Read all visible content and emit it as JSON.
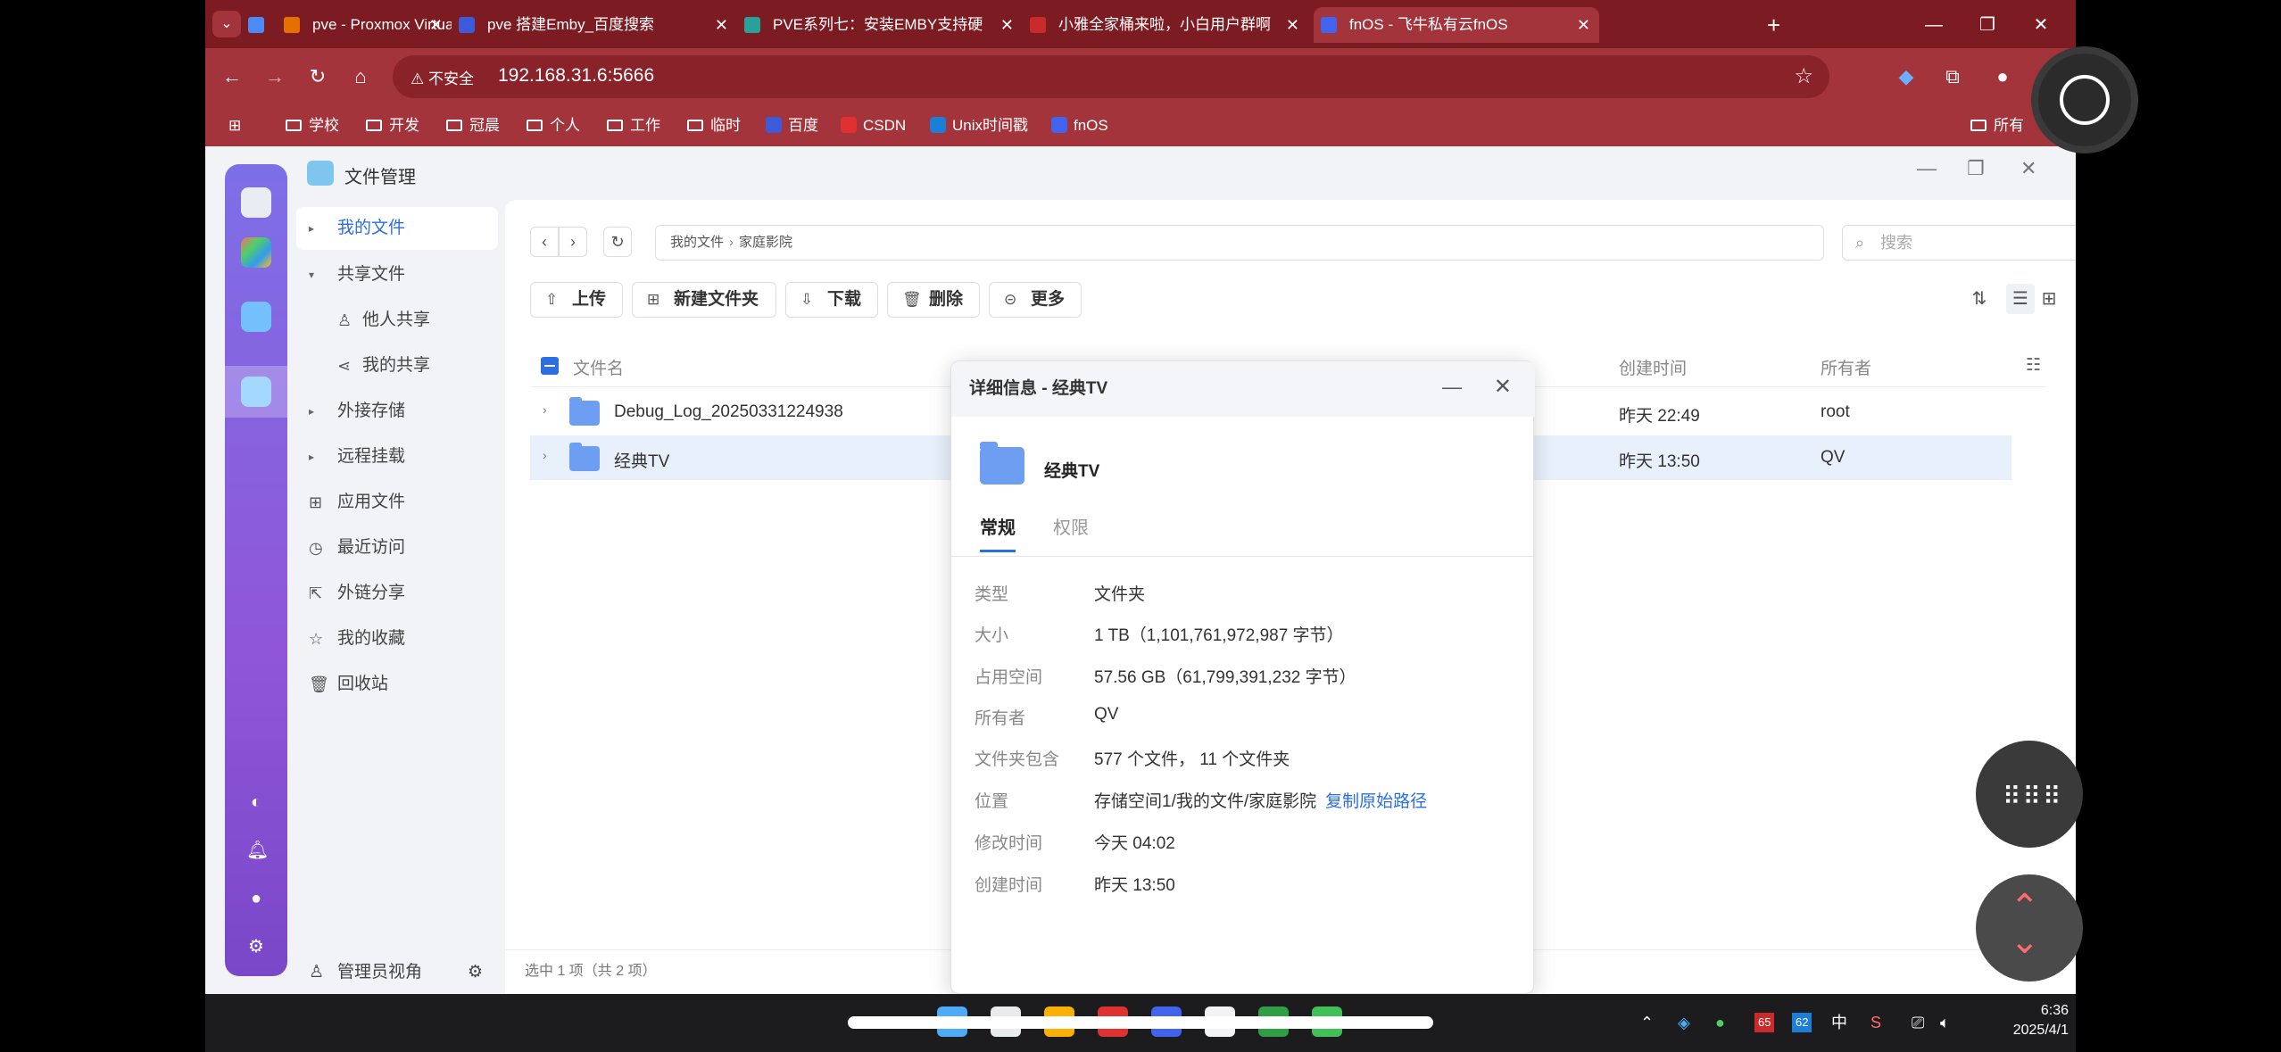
{
  "browser": {
    "tabs": [
      {
        "title": "pve - Proxmox Virtual Enviro",
        "icon_color": "#e57000"
      },
      {
        "title": "pve 搭建Emby_百度搜索",
        "icon_color": "#3b5bdb"
      },
      {
        "title": "PVE系列七：安装EMBY支持硬",
        "icon_color": "#2aa198"
      },
      {
        "title": "小雅全家桶来啦，小白用户群啊",
        "icon_color": "#c92a2a"
      },
      {
        "title": "fnOS - 飞牛私有云fnOS",
        "icon_color": "#4263eb"
      }
    ],
    "security_label": "不安全",
    "url": "192.168.31.6:5666",
    "bookmarks": [
      "学校",
      "开发",
      "冠晨",
      "个人",
      "工作",
      "临时",
      "百度",
      "CSDN",
      "Unix时间戳",
      "fnOS"
    ],
    "bookmarks_overflow": "所有"
  },
  "app": {
    "title": "文件管理",
    "sidebar": {
      "my_files": "我的文件",
      "shared_files": "共享文件",
      "others_share": "他人共享",
      "my_share": "我的共享",
      "external_storage": "外接存储",
      "remote_mount": "远程挂载",
      "app_files": "应用文件",
      "recent": "最近访问",
      "link_share": "外链分享",
      "favorites": "我的收藏",
      "recycle": "回收站",
      "admin_view": "管理员视角"
    },
    "breadcrumb": [
      "我的文件",
      "家庭影院"
    ],
    "search_placeholder": "搜索",
    "toolbar": {
      "upload": "上传",
      "new_folder": "新建文件夹",
      "download": "下载",
      "delete": "删除",
      "more": "更多"
    },
    "columns": {
      "name": "文件名",
      "created": "创建时间",
      "owner": "所有者"
    },
    "rows": [
      {
        "name": "Debug_Log_20250331224938",
        "created": "昨天 22:49",
        "owner": "root"
      },
      {
        "name": "经典TV",
        "created": "昨天 13:50",
        "owner": "QV"
      }
    ],
    "status": "选中 1 项（共 2 项）"
  },
  "dialog": {
    "title": "详细信息 - 经典TV",
    "name": "经典TV",
    "tabs": [
      "常规",
      "权限"
    ],
    "props": [
      {
        "k": "类型",
        "v": "文件夹"
      },
      {
        "k": "大小",
        "v": "1 TB（1,101,761,972,987 字节）"
      },
      {
        "k": "占用空间",
        "v": "57.56 GB（61,799,391,232 字节）"
      },
      {
        "k": "所有者",
        "v": "QV"
      },
      {
        "k": "文件夹包含",
        "v": "577 个文件， 11 个文件夹"
      },
      {
        "k": "位置",
        "v": "存储空间1/我的文件/家庭影院"
      },
      {
        "k": "修改时间",
        "v": "今天 04:02"
      },
      {
        "k": "创建时间",
        "v": "昨天 13:50"
      }
    ],
    "copy_path": "复制原始路径"
  },
  "taskbar": {
    "tray_ime": "中",
    "badge1": "65",
    "badge2": "62",
    "time": "6:36",
    "date": "2025/4/1"
  }
}
